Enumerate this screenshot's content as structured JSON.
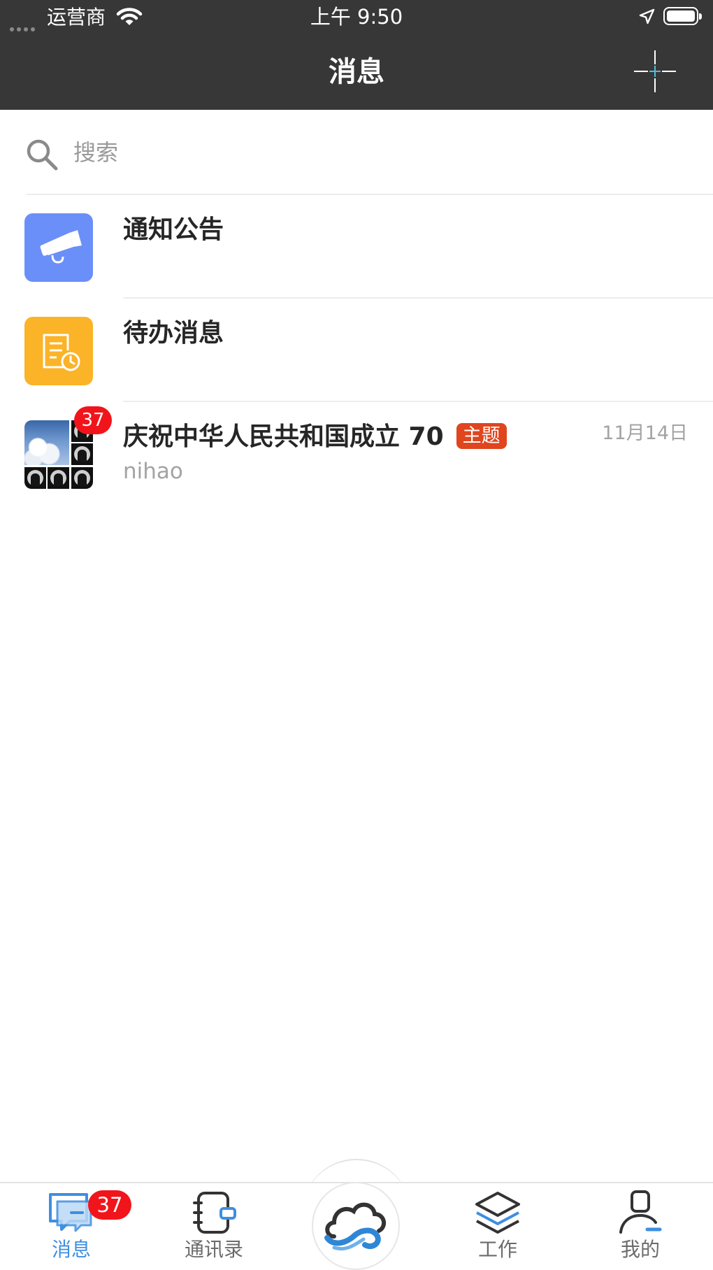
{
  "status_bar": {
    "carrier": "运营商",
    "time": "上午 9:50"
  },
  "nav": {
    "title": "消息"
  },
  "search": {
    "placeholder": "搜索"
  },
  "messages": [
    {
      "title": "通知公告"
    },
    {
      "title": "待办消息"
    },
    {
      "title": "庆祝中华人民共和国成立 70",
      "tag": "主题",
      "subtitle": "nihao",
      "date": "11月14日",
      "unread": "37"
    }
  ],
  "tabs": [
    {
      "label": "消息",
      "badge": "37",
      "active": true
    },
    {
      "label": "通讯录"
    },
    {
      "label": "工作"
    },
    {
      "label": "我的"
    }
  ],
  "colors": {
    "bar_bg": "#373737",
    "accent": "#3d8fe0",
    "notice_icon_bg": "#6b8ff8",
    "todo_icon_bg": "#fbb328",
    "badge": "#f2141b",
    "topic_tag": "#e0451e"
  },
  "icons": [
    "signal-dots-icon",
    "wifi-icon",
    "location-arrow-icon",
    "battery-icon",
    "scan-icon",
    "search-icon",
    "megaphone-icon",
    "todo-clock-icon",
    "chat-bubble-icon",
    "contacts-book-icon",
    "cloud-logo-icon",
    "layers-icon",
    "user-icon"
  ]
}
